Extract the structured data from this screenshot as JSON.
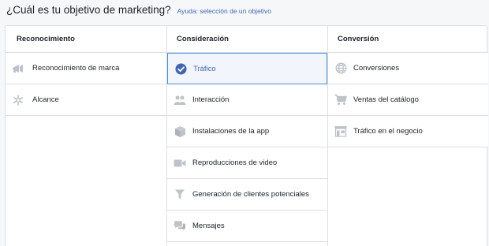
{
  "header": {
    "title": "¿Cuál es tu objetivo de marketing?",
    "help": "Ayuda: selección de un objetivo"
  },
  "columns": [
    {
      "title": "Reconocimiento",
      "items": [
        {
          "label": "Reconocimiento de marca",
          "icon": "megaphone-icon"
        },
        {
          "label": "Alcance",
          "icon": "asterisk-icon"
        }
      ]
    },
    {
      "title": "Consideración",
      "items": [
        {
          "label": "Tráfico",
          "icon": "checkmark-icon",
          "selected": true
        },
        {
          "label": "Interacción",
          "icon": "people-icon"
        },
        {
          "label": "Instalaciones de la app",
          "icon": "box-icon"
        },
        {
          "label": "Reproducciones de video",
          "icon": "video-camera-icon"
        },
        {
          "label": "Generación de clientes potenciales",
          "icon": "funnel-icon"
        },
        {
          "label": "Mensajes",
          "icon": "chat-bubbles-icon"
        }
      ]
    },
    {
      "title": "Conversión",
      "items": [
        {
          "label": "Conversiones",
          "icon": "globe-icon"
        },
        {
          "label": "Ventas del catálogo",
          "icon": "shopping-cart-icon"
        },
        {
          "label": "Tráfico en el negocio",
          "icon": "storefront-icon"
        }
      ]
    }
  ],
  "colors": {
    "accent": "#4267b2",
    "selected_border": "#4a90e2",
    "icon_gray": "#bec3c9",
    "border": "#dddfe2"
  }
}
